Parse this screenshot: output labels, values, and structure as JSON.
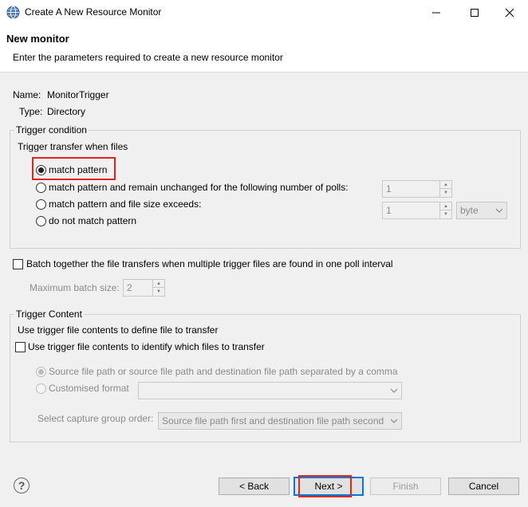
{
  "window": {
    "title": "Create A New Resource Monitor"
  },
  "header": {
    "title": "New monitor",
    "description": "Enter the parameters required to create a new resource monitor"
  },
  "info": {
    "name_label": "Name:",
    "name_value": "MonitorTrigger",
    "type_label": "Type:",
    "type_value": "Directory"
  },
  "trigger_condition": {
    "title": "Trigger condition",
    "subtitle": "Trigger transfer when files",
    "options": [
      {
        "label": "match pattern",
        "selected": true
      },
      {
        "label": "match pattern and remain unchanged for the following number of polls:",
        "selected": false
      },
      {
        "label": "match pattern and file size exceeds:",
        "selected": false
      },
      {
        "label": "do not match pattern",
        "selected": false
      }
    ],
    "polls_value": "1",
    "size_value": "1",
    "size_unit": "byte"
  },
  "batch": {
    "checkbox_label": "Batch together the file transfers when multiple trigger files are found in one poll interval",
    "checked": false,
    "max_label": "Maximum batch size:",
    "max_value": "2"
  },
  "trigger_content": {
    "title": "Trigger Content",
    "subtitle": "Use trigger file contents to define file to transfer",
    "checkbox_label": "Use trigger file contents to identify which files to transfer",
    "checked": false,
    "option_source": "Source file path or source file path and destination file path separated by a comma",
    "option_custom": "Customised format",
    "custom_value": "",
    "capture_label": "Select capture group order:",
    "capture_value": "Source file path first and destination file path second"
  },
  "footer": {
    "help": "?",
    "back": "< Back",
    "next": "Next >",
    "finish": "Finish",
    "cancel": "Cancel"
  },
  "colors": {
    "highlight": "#e0261b",
    "default_button": "#0078d7"
  }
}
